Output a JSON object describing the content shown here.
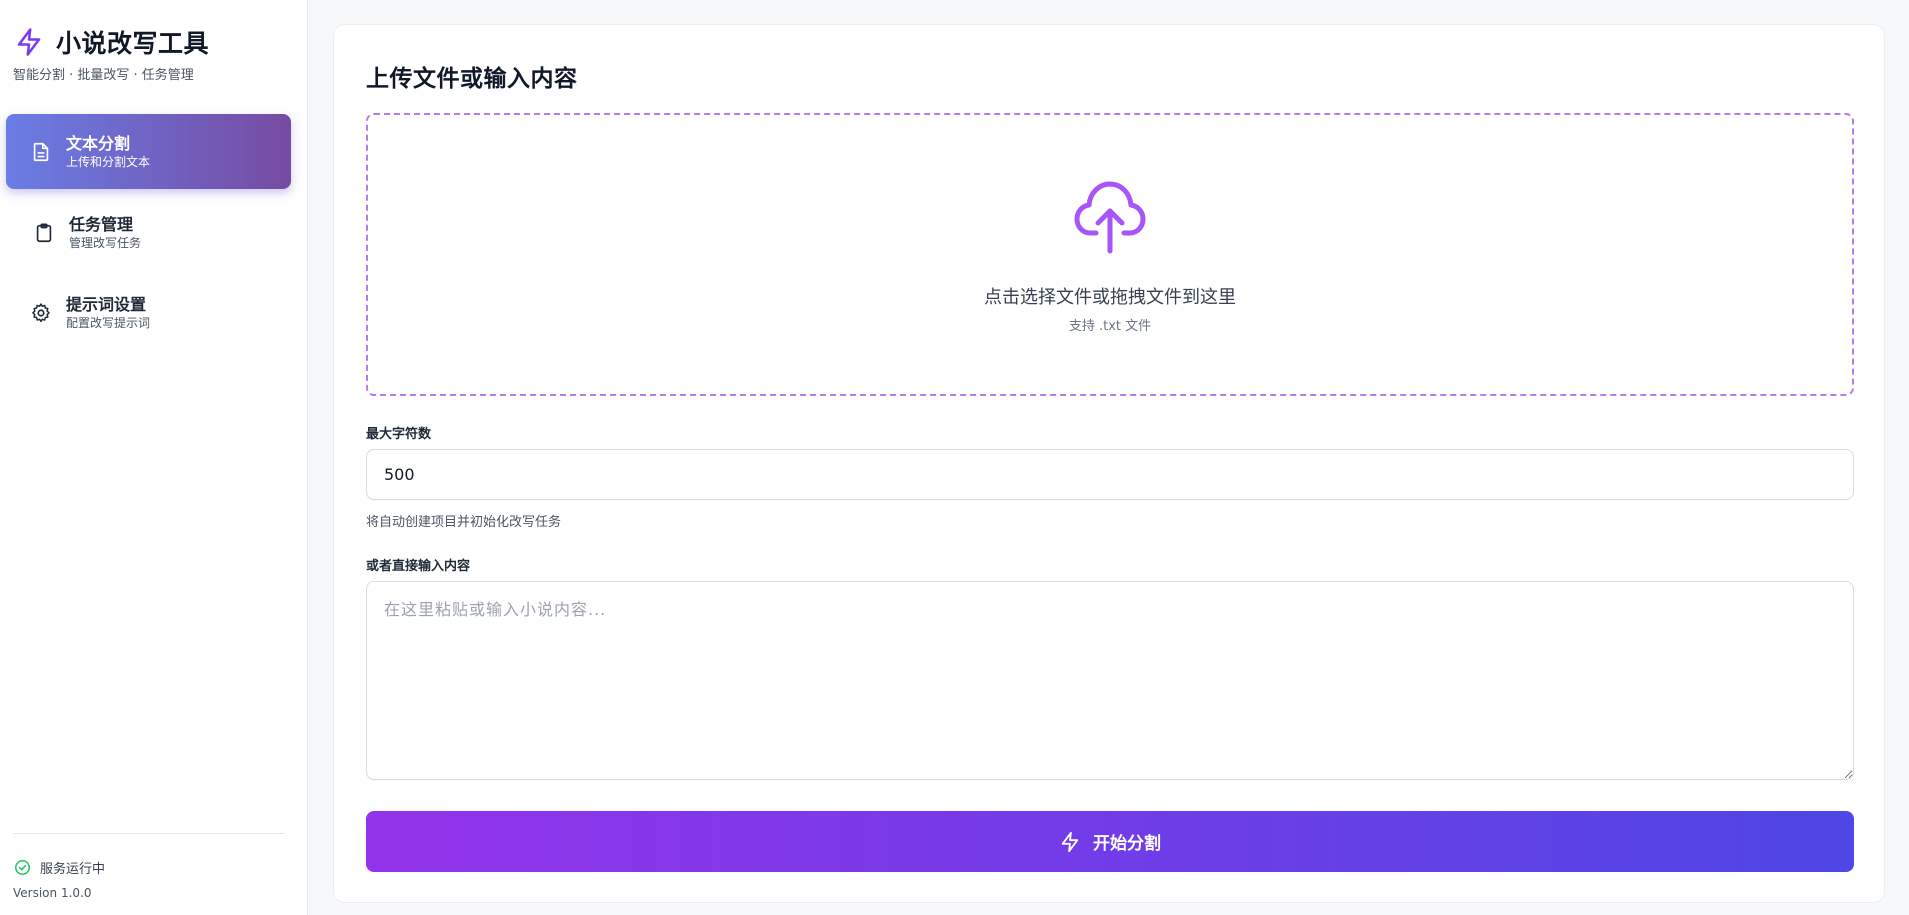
{
  "app": {
    "title": "小说改写工具",
    "subtitle": "智能分割 · 批量改写 · 任务管理",
    "icon": "lightning-icon"
  },
  "sidebar": {
    "items": [
      {
        "label": "文本分割",
        "desc": "上传和分割文本",
        "icon": "document-icon",
        "active": true
      },
      {
        "label": "任务管理",
        "desc": "管理改写任务",
        "icon": "clipboard-icon",
        "active": false
      },
      {
        "label": "提示词设置",
        "desc": "配置改写提示词",
        "icon": "gear-icon",
        "active": false
      }
    ],
    "status": {
      "text": "服务运行中",
      "icon": "check-circle-icon",
      "color": "#22c55e"
    },
    "version": "Version 1.0.0"
  },
  "main": {
    "title": "上传文件或输入内容",
    "upload": {
      "main_text": "点击选择文件或拖拽文件到这里",
      "sub_text": "支持 .txt 文件",
      "icon": "cloud-upload-icon"
    },
    "max_chars": {
      "label": "最大字符数",
      "value": "500",
      "hint": "将自动创建项目并初始化改写任务"
    },
    "content": {
      "label": "或者直接输入内容",
      "placeholder": "在这里粘贴或输入小说内容..."
    },
    "submit": {
      "label": "开始分割",
      "icon": "lightning-icon"
    }
  },
  "colors": {
    "accent": "#a855f7",
    "nav_active_start": "#6a7de6",
    "nav_active_end": "#764ba2",
    "button_start": "#9333ea",
    "button_end": "#4f46e5"
  }
}
